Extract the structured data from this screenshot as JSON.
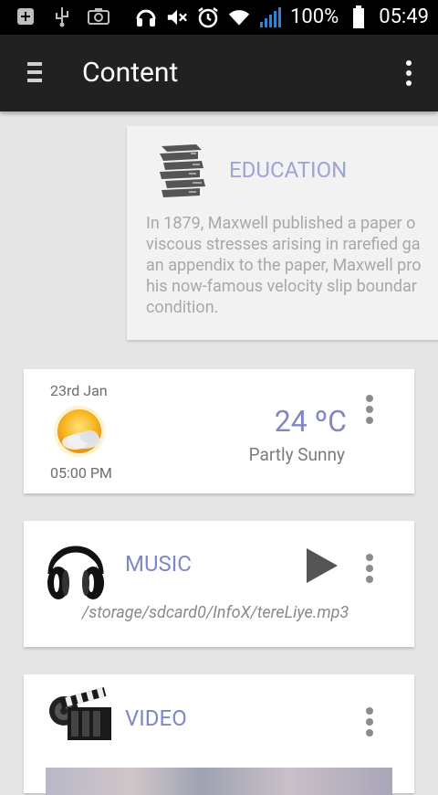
{
  "status_bar": {
    "battery_percent": "100%",
    "time": "05:49",
    "left_icons": [
      "add-box-icon",
      "usb-icon",
      "screenshot-icon"
    ],
    "right_icons": [
      "headphones-icon",
      "mute-icon",
      "alarm-icon",
      "wifi-icon",
      "signal-icon",
      "battery-icon"
    ]
  },
  "app_bar": {
    "title": "Content",
    "menu_icon": "menu-icon",
    "more_icon": "more-vert-icon"
  },
  "education": {
    "title": "EDUCATION",
    "icon": "books-icon",
    "lines": [
      "In 1879, Maxwell published a paper o",
      "viscous stresses arising in rarefied ga",
      "an appendix to the paper, Maxwell pro",
      "his now-famous velocity slip boundar",
      "condition."
    ]
  },
  "weather": {
    "date": "23rd Jan",
    "time": "05:00 PM",
    "temperature": "24 ºC",
    "condition": "Partly Sunny",
    "icon": "partly-sunny-icon"
  },
  "music": {
    "title": "MUSIC",
    "path": "/storage/sdcard0/InfoX/tereLiye.mp3",
    "icon": "headphones-icon"
  },
  "video": {
    "title": "VIDEO",
    "icon": "clapperboard-icon"
  },
  "colors": {
    "status_bar": "#000000",
    "app_bar": "#212121",
    "accent": "#7f88c6",
    "background": "#e6e6e6"
  }
}
